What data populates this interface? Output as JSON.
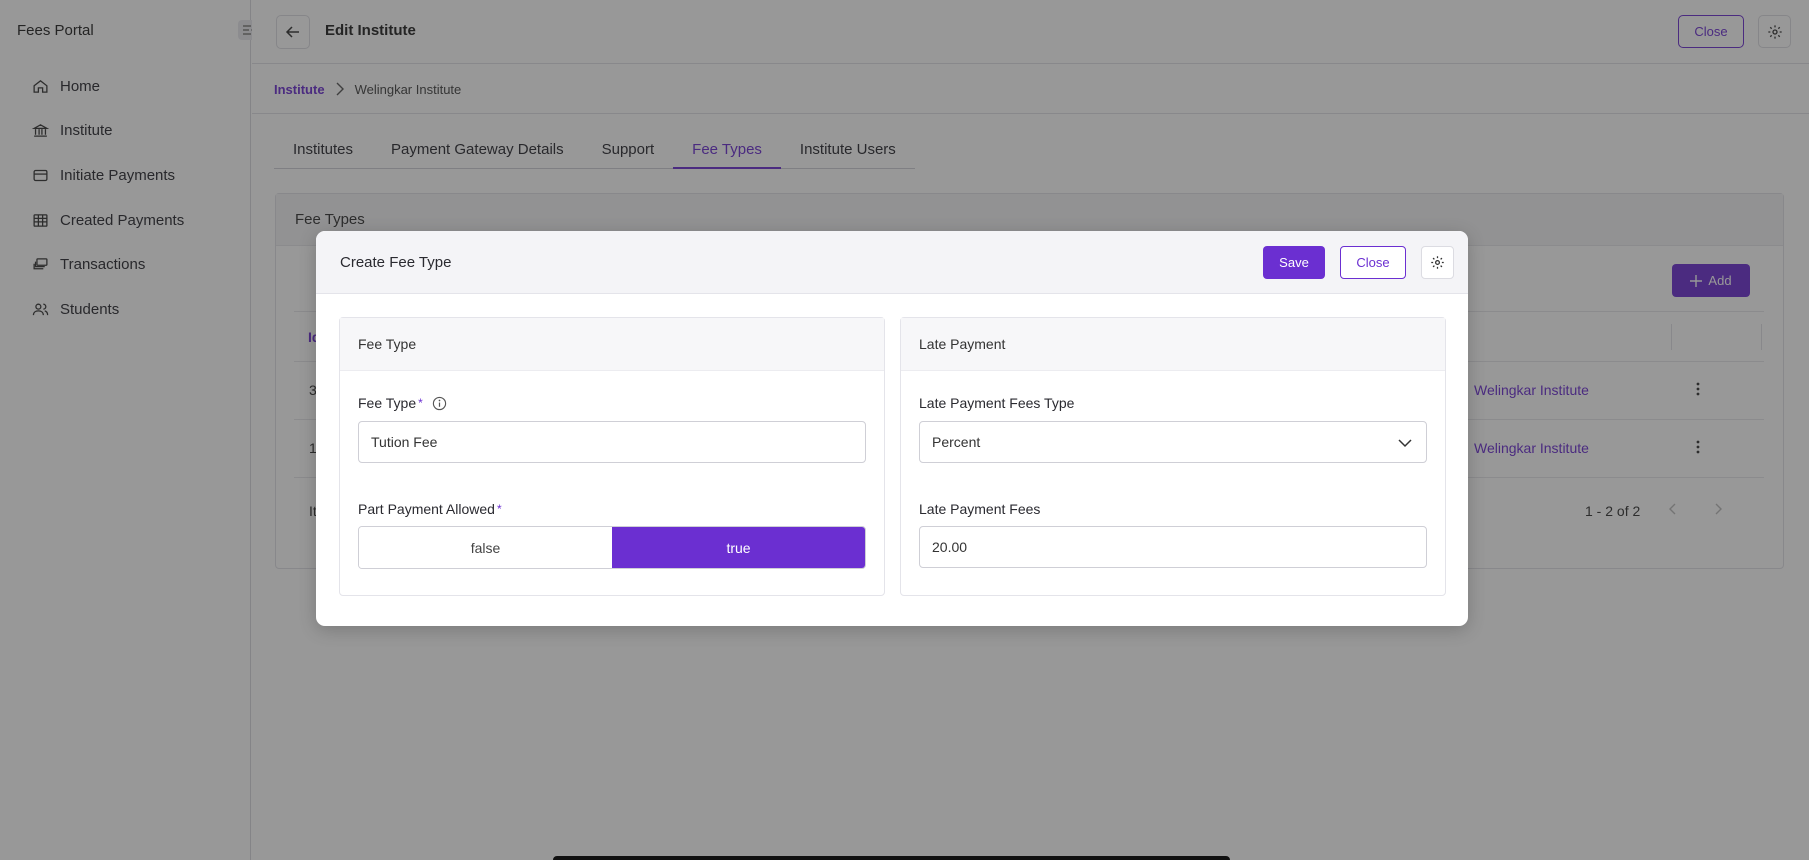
{
  "sidebar": {
    "title": "Fees Portal",
    "items": [
      {
        "label": "Home"
      },
      {
        "label": "Institute"
      },
      {
        "label": "Initiate Payments"
      },
      {
        "label": "Created Payments"
      },
      {
        "label": "Transactions"
      },
      {
        "label": "Students"
      }
    ]
  },
  "header": {
    "title": "Edit Institute",
    "close_label": "Close"
  },
  "breadcrumb": {
    "parent": "Institute",
    "current": "Welingkar Institute"
  },
  "tabs": [
    {
      "label": "Institutes"
    },
    {
      "label": "Payment Gateway Details"
    },
    {
      "label": "Support"
    },
    {
      "label": "Fee Types"
    },
    {
      "label": "Institute Users"
    }
  ],
  "fee_types_card": {
    "title": "Fee Types",
    "add_label": "Add",
    "header_col0": "Id",
    "rows": [
      {
        "id": "3",
        "institute": "Welingkar Institute"
      },
      {
        "id": "1",
        "institute": "Welingkar Institute"
      }
    ],
    "footer_left": "It",
    "range": "1 - 2 of 2"
  },
  "modal": {
    "title": "Create Fee Type",
    "save_label": "Save",
    "close_label": "Close",
    "fee_type_panel": {
      "title": "Fee Type",
      "fee_type_label": "Fee Type",
      "fee_type_value": "Tution Fee",
      "part_payment_label": "Part Payment Allowed",
      "part_payment_options": [
        "false",
        "true"
      ],
      "part_payment_selected": "true"
    },
    "late_payment_panel": {
      "title": "Late Payment",
      "fees_type_label": "Late Payment Fees Type",
      "fees_type_value": "Percent",
      "fees_label": "Late Payment Fees",
      "fees_value": "20.00"
    }
  },
  "colors": {
    "accent": "#6b2fd1"
  }
}
